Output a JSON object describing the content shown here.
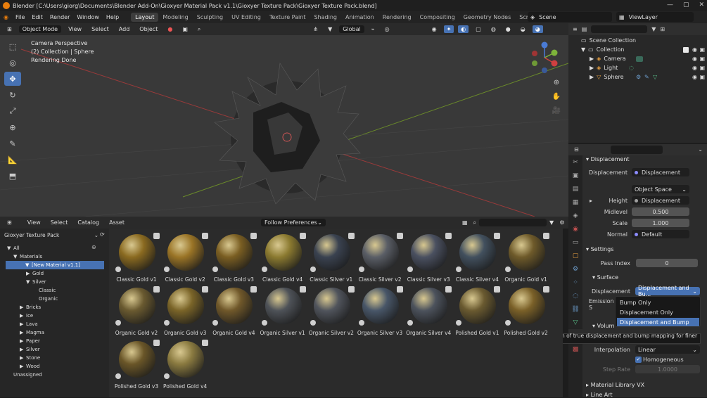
{
  "window": {
    "title": "Blender [C:\\Users\\giorg\\Documents\\Blender Add-On\\Gioxyer Material Pack v1.1\\Gioxyer Texture Pack\\Gioxyer Texture Pack.blend]",
    "controls": [
      "—",
      "▢",
      "✕"
    ]
  },
  "menu": [
    "File",
    "Edit",
    "Render",
    "Window",
    "Help"
  ],
  "workspaces": [
    "Layout",
    "Modeling",
    "Sculpting",
    "UV Editing",
    "Texture Paint",
    "Shading",
    "Animation",
    "Rendering",
    "Compositing",
    "Geometry Nodes",
    "Scripting"
  ],
  "active_workspace": "Layout",
  "add_workspace": "+",
  "scene": "Scene",
  "view_layer": "ViewLayer",
  "viewport": {
    "mode": "Object Mode",
    "menus": [
      "View",
      "Select",
      "Add",
      "Object"
    ],
    "transform_orientation": "Global",
    "info": [
      "Camera Perspective",
      "(2) Collection | Sphere",
      "Rendering Done"
    ]
  },
  "outliner": {
    "root": "Scene Collection",
    "collection": "Collection",
    "items": [
      "Camera",
      "Light",
      "Sphere"
    ]
  },
  "properties": {
    "displacement_section": "Displacement",
    "displacement_label": "Displacement",
    "displacement_value": "Displacement",
    "space_value": "Object Space",
    "height_label": "Height",
    "height_value": "Displacement",
    "midlevel_label": "Midlevel",
    "midlevel_value": "0.500",
    "scale_label": "Scale",
    "scale_value": "1.000",
    "normal_label": "Normal",
    "normal_value": "Default",
    "settings_section": "Settings",
    "pass_index_label": "Pass Index",
    "pass_index_value": "0",
    "surface_section": "Surface",
    "surface_disp_label": "Displacement",
    "surface_disp_value": "Displacement and Bu...",
    "emission_label": "Emission S",
    "volume_section": "Volum",
    "interpolation_label": "Interpolation",
    "interpolation_value": "Linear",
    "homogeneous_label": "Homogeneous",
    "steprate_label": "Step Rate",
    "steprate_value": "1.0000",
    "material_library_section": "Material Library VX",
    "line_art_section": "Line Art"
  },
  "dropdown": {
    "options": [
      "Bump Only",
      "Displacement Only",
      "Displacement and Bump"
    ],
    "selected": "Displacement and Bump"
  },
  "tooltip": "Combination of true displacement and bump mapping for finer detail.",
  "asset_browser": {
    "menus": [
      "View",
      "Select",
      "Catalog",
      "Asset"
    ],
    "library": "Gioxyer Texture Pack",
    "import_method": "Follow Preferences",
    "tree": [
      {
        "label": "All",
        "depth": 0,
        "arrow": "▼"
      },
      {
        "label": "Materials",
        "depth": 1,
        "arrow": "▼"
      },
      {
        "label": "[New Material v1.1]",
        "depth": 2,
        "arrow": "▼",
        "selected": true
      },
      {
        "label": "Gold",
        "depth": 3,
        "arrow": "▶"
      },
      {
        "label": "Silver",
        "depth": 3,
        "arrow": "▼"
      },
      {
        "label": "Classic",
        "depth": 4,
        "arrow": ""
      },
      {
        "label": "Organic",
        "depth": 4,
        "arrow": ""
      },
      {
        "label": "Bricks",
        "depth": 2,
        "arrow": "▶"
      },
      {
        "label": "Ice",
        "depth": 2,
        "arrow": "▶"
      },
      {
        "label": "Lava",
        "depth": 2,
        "arrow": "▶"
      },
      {
        "label": "Magma",
        "depth": 2,
        "arrow": "▶"
      },
      {
        "label": "Paper",
        "depth": 2,
        "arrow": "▶"
      },
      {
        "label": "Silver",
        "depth": 2,
        "arrow": "▶"
      },
      {
        "label": "Stone",
        "depth": 2,
        "arrow": "▶"
      },
      {
        "label": "Wood",
        "depth": 2,
        "arrow": "▶"
      },
      {
        "label": "Unassigned",
        "depth": 0,
        "arrow": ""
      }
    ],
    "materials": [
      {
        "name": "Classic Gold v1",
        "color": "#8a6a20"
      },
      {
        "name": "Classic Gold v2",
        "color": "#9a7426"
      },
      {
        "name": "Classic Gold v3",
        "color": "#7a5e22"
      },
      {
        "name": "Classic Gold v4",
        "color": "#8b7a30"
      },
      {
        "name": "Classic Silver v1",
        "color": "#3a4250"
      },
      {
        "name": "Classic Silver v2",
        "color": "#5a5e66"
      },
      {
        "name": "Classic Silver v3",
        "color": "#4a5060"
      },
      {
        "name": "Classic Silver v4",
        "color": "#42505e"
      },
      {
        "name": "Organic Gold v1",
        "color": "#6e5a2a"
      },
      {
        "name": "Organic Gold v2",
        "color": "#6a5a30"
      },
      {
        "name": "Organic Gold v3",
        "color": "#7a6428"
      },
      {
        "name": "Organic Gold v4",
        "color": "#70582a"
      },
      {
        "name": "Organic Silver v1",
        "color": "#4e5258"
      },
      {
        "name": "Organic Silver v2",
        "color": "#50545c"
      },
      {
        "name": "Organic Silver v3",
        "color": "#485668"
      },
      {
        "name": "Organic Silver v4",
        "color": "#4c525c"
      },
      {
        "name": "Polished Gold v1",
        "color": "#6a5a30"
      },
      {
        "name": "Polished Gold v2",
        "color": "#7a6028"
      },
      {
        "name": "Polished Gold v3",
        "color": "#6a5628"
      },
      {
        "name": "Polished Gold v4",
        "color": "#8a7a40"
      }
    ]
  }
}
